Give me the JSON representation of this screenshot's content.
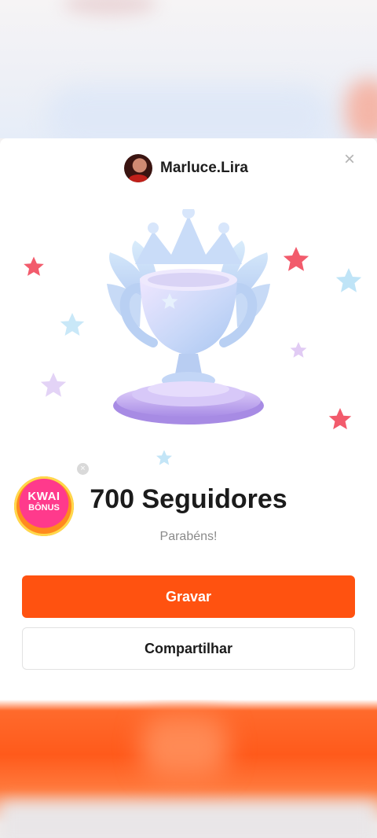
{
  "user": {
    "name": "Marluce.Lira"
  },
  "badge": {
    "line1": "KWAI",
    "line2": "BÔNUS"
  },
  "milestone": {
    "title": "700 Seguidores",
    "subtitle": "Parabéns!"
  },
  "actions": {
    "primary_label": "Gravar",
    "secondary_label": "Compartilhar"
  },
  "icons": {
    "close": "close-icon",
    "dismiss_badge": "close-small-icon",
    "illustration": "trophy-icon"
  },
  "colors": {
    "accent": "#ff5210",
    "trophy_light": "#e8e2fb",
    "trophy_blue": "#b9d4f6",
    "star_red": "#f25b6c",
    "star_blue": "#bfe4f7"
  }
}
